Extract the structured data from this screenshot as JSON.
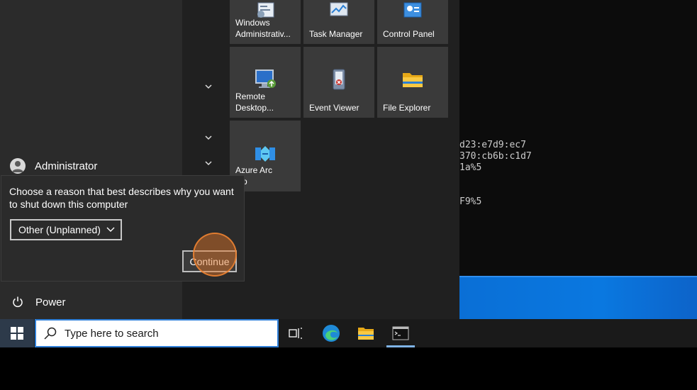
{
  "terminal": {
    "lines": [
      {
        "text": "d23:e7d9:ec7"
      },
      {
        "text": "370:cb6b:c1d7"
      },
      {
        "text": "1a%5"
      },
      {
        "text": "F9%5"
      }
    ]
  },
  "start_menu": {
    "tiles": [
      {
        "label": "Windows\nAdministrativ...",
        "icon": "admin-tools-icon"
      },
      {
        "label": "Task Manager",
        "icon": "task-manager-icon"
      },
      {
        "label": "Control Panel",
        "icon": "control-panel-icon"
      },
      {
        "label": "Remote\nDesktop...",
        "icon": "remote-desktop-icon"
      },
      {
        "label": "Event Viewer",
        "icon": "event-viewer-icon"
      },
      {
        "label": "File Explorer",
        "icon": "file-explorer-icon"
      },
      {
        "label": "Azure Arc\ntup",
        "icon": "azure-arc-icon"
      }
    ],
    "user": {
      "name": "Administrator"
    },
    "power": {
      "label": "Power"
    }
  },
  "shutdown_dialog": {
    "prompt": "Choose a reason that best describes why you want to shut down this computer",
    "reason_selected": "Other (Unplanned)",
    "continue_label": "Continue"
  },
  "taskbar": {
    "search_placeholder": "Type here to search",
    "accent": "#2f7fd8"
  }
}
